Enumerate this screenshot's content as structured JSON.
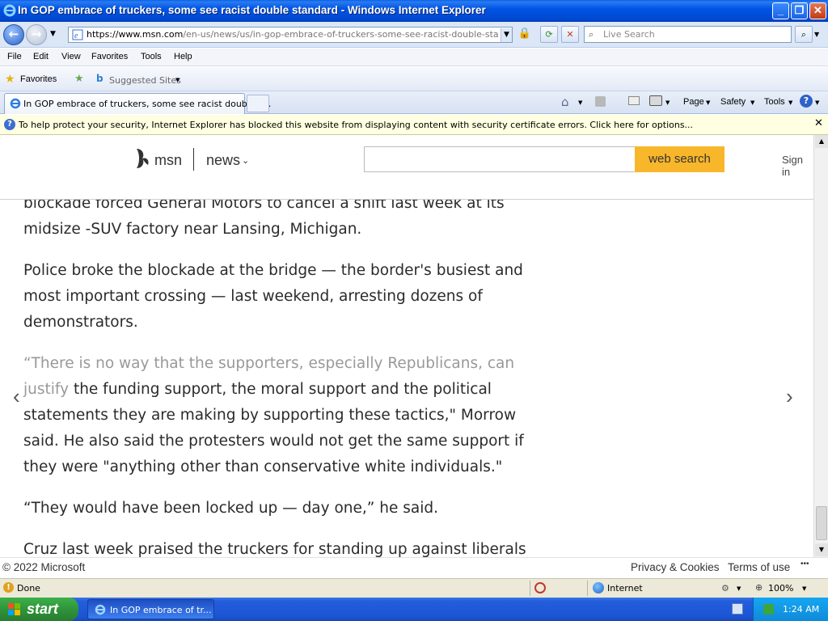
{
  "window": {
    "title": "In GOP embrace of truckers, some see racist double standard - Windows Internet Explorer",
    "controls": {
      "minimize": "_",
      "maximize": "❐",
      "close": "✕"
    }
  },
  "address_bar": {
    "url_prefix": "https://",
    "url_host": "www.msn.com",
    "url_path": "/en-us/news/us/in-gop-embrace-of-truckers-some-see-racist-double-standard/ar-A",
    "search_placeholder": "Live Search"
  },
  "menu": [
    "File",
    "Edit",
    "View",
    "Favorites",
    "Tools",
    "Help"
  ],
  "favorites_bar": {
    "favorites": "Favorites",
    "suggested": "Suggested Sites"
  },
  "tab": {
    "label": "In GOP embrace of truckers, some see racist double s..."
  },
  "command_bar": {
    "page": "Page",
    "safety": "Safety",
    "tools": "Tools"
  },
  "info_bar": {
    "text": "To help protect your security, Internet Explorer has blocked this website from displaying content with security certificate errors. Click here for options..."
  },
  "msn": {
    "brand": "msn",
    "section": "news",
    "search_button": "web search",
    "sign_in": "Sign in"
  },
  "article": {
    "p1": "blockade forced General Motors to cancel a shift last week at its midsize -SUV factory near Lansing, Michigan.",
    "p2": "Police broke the blockade at the bridge — the border's busiest and most important crossing — last weekend, arresting dozens of demonstrators.",
    "p3_lead": "“There is no way that the supporters, especially Republicans, can justify",
    "p3_rest": "the funding support, the moral support and the political statements they are making by supporting these tactics,\" Morrow said. He also said the protesters would not get the same support if they were \"anything other than conservative white individuals.\"",
    "p4": "“They would have been locked up — day one,” he said.",
    "p5": "Cruz last week praised the truckers for standing up against liberals who"
  },
  "footer": {
    "copyright": "© 2022 Microsoft",
    "privacy": "Privacy & Cookies",
    "terms": "Terms of use",
    "more": "•••"
  },
  "status_bar": {
    "status": "Done",
    "zone": "Internet",
    "zoom": "100%"
  },
  "taskbar": {
    "start": "start",
    "item": "In GOP embrace of tr...",
    "clock": "1:24 AM"
  },
  "colors": {
    "msn_search_button": "#f8b62b",
    "xp_blue": "#245edc",
    "info_bar": "#ffffe1"
  }
}
